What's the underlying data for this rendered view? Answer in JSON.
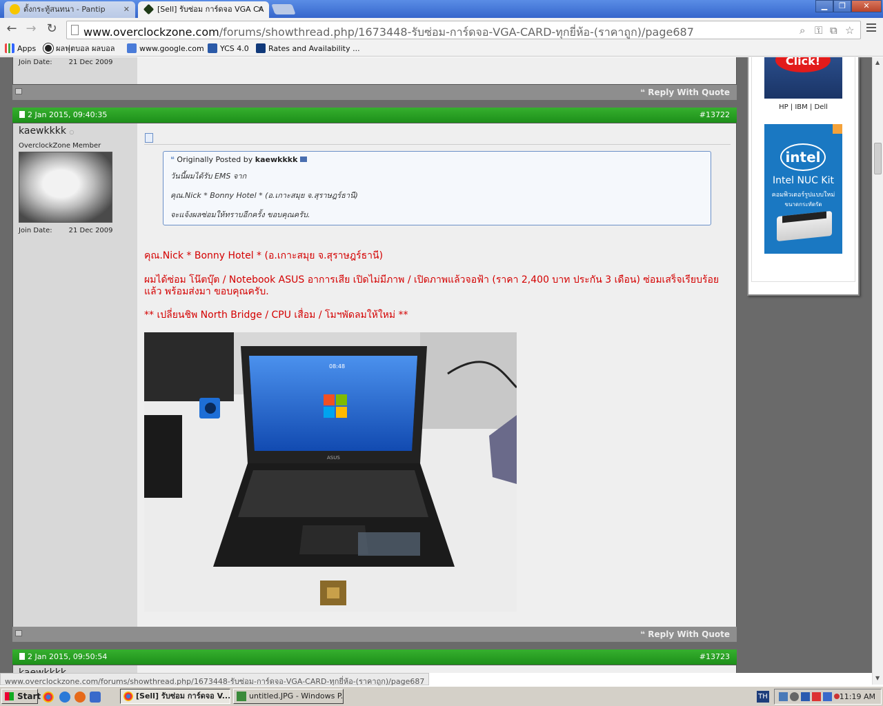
{
  "browser": {
    "tabs": [
      {
        "label": "ตั้งกระทู้สนทนา - Pantip",
        "active": false
      },
      {
        "label": "[Sell] รับซ่อม การ์ดจอ VGA CA",
        "active": true
      }
    ],
    "close_glyph": "✕",
    "window_buttons": {
      "minimize": "▁",
      "maximize": "❐",
      "close": "✕"
    },
    "url_host": "www.overclockzone.com",
    "url_path": "/forums/showthread.php/1673448-รับซ่อม-การ์ดจอ-VGA-CARD-ทุกยี่ห้อ-(ราคาถูก)/page687",
    "nav": {
      "back": "←",
      "forward": "→",
      "reload": "↻"
    },
    "omnibox_icons": [
      "zoom-icon",
      "key-icon",
      "translate-icon",
      "star-icon"
    ],
    "bookmarks": [
      {
        "label": "Apps",
        "icon": "apps-grid-icon"
      },
      {
        "label": "ผลฟุตบอล ผลบอล",
        "icon": "soccer-ball-icon"
      },
      {
        "label": "www.google.com",
        "icon": "google-icon"
      },
      {
        "label": "YCS 4.0",
        "icon": "ycs-icon"
      },
      {
        "label": "Rates and Availability ...",
        "icon": "booking-icon"
      }
    ]
  },
  "thread": {
    "prev_post": {
      "join_label": "Join Date:",
      "join_value": "21 Dec 2009",
      "reply_label": "Reply With Quote"
    },
    "post": {
      "date": "2 Jan 2015, 09:40:35",
      "number": "#13722",
      "username": "kaewkkkk",
      "user_title": "OverclockZone Member",
      "join_label": "Join Date:",
      "join_value": "21 Dec 2009",
      "quote_prefix": "Originally Posted by",
      "quote_author": "kaewkkkk",
      "quote_lines": [
        "วันนี้ผมได้รับ EMS จาก",
        "คุณ.Nick * Bonny Hotel * (อ.เกาะสมุย จ.สุราษฎร์ธานี)",
        "จะแจ้งผลซ่อมให้ทราบอีกครั้ง ขอบคุณครับ."
      ],
      "body_lines": [
        "คุณ.Nick * Bonny Hotel * (อ.เกาะสมุย จ.สุราษฎร์ธานี)",
        "ผมได้ซ่อม โน๊ตบุ๊ต / Notebook ASUS อาการเสีย เปิดไม่มีภาพ / เปิดภาพแล้วจอฟ้า (ราคา 2,400 บาท ประกัน 3 เดือน) ซ่อมเสร็จเรียบร้อยแล้ว พร้อมส่งมา ขอบคุณครับ.",
        "** เปลี่ยนชิพ North Bridge / CPU เสื่อม / โมฯพัดลมให้ใหม่ **"
      ],
      "laptop_clock": "08:48",
      "laptop_brand": "ASUS",
      "reply_label": "Reply With Quote"
    },
    "next_post": {
      "date": "2 Jan 2015, 09:50:54",
      "number": "#13723",
      "username": "kaewkkkk"
    }
  },
  "sidebar": {
    "hp_ad_text": "Click!",
    "hp_caption": "HP | IBM | Dell",
    "intel_logo": "intel",
    "intel_title": "Intel NUC Kit",
    "intel_sub1": "คอมพิวเตอร์รูปแบบใหม่",
    "intel_sub2": "ขนาดกระทัดรัด"
  },
  "status_url": "www.overclockzone.com/forums/showthread.php/1673448-รับซ่อม-การ์ดจอ-VGA-CARD-ทุกยี่ห้อ-(ราคาถูก)/page687",
  "taskbar": {
    "start_label": "Start",
    "items": [
      {
        "label": "[Sell] รับซ่อม การ์ดจอ V...",
        "active": true
      },
      {
        "label": "untitled.JPG - Windows P...",
        "active": false
      }
    ],
    "lang": "TH",
    "clock": "11:19 AM"
  },
  "colors": {
    "post_header": "#2a9f25",
    "body_red": "#d40000",
    "quote_border": "#6a8fc7"
  }
}
